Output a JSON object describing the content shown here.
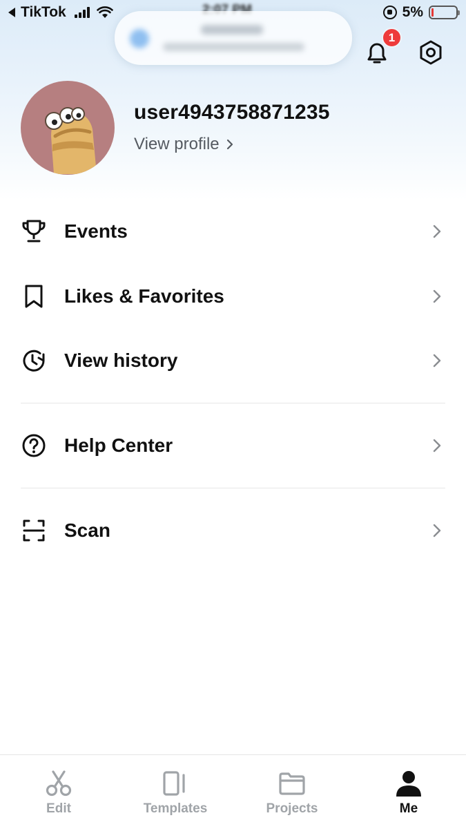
{
  "status_bar": {
    "back_app": "TikTok",
    "time": "2:07 PM",
    "battery": "5%"
  },
  "notification_pill": {
    "title": "",
    "subtitle": ""
  },
  "header": {
    "bell_icon": "bell-icon",
    "notification_count": "1",
    "settings_icon": "hexagon-settings-icon"
  },
  "profile": {
    "username": "user4943758871235",
    "view_profile": "View profile"
  },
  "menu": [
    {
      "label": "Events",
      "icon": "trophy-icon"
    },
    {
      "label": "Likes & Favorites",
      "icon": "bookmark-icon"
    },
    {
      "label": "View history",
      "icon": "history-icon"
    },
    {
      "label": "Help Center",
      "icon": "help-icon"
    },
    {
      "label": "Scan",
      "icon": "scan-icon"
    }
  ],
  "bottom_nav": [
    {
      "label": "Edit",
      "icon": "scissors-icon",
      "active": false
    },
    {
      "label": "Templates",
      "icon": "templates-icon",
      "active": false
    },
    {
      "label": "Projects",
      "icon": "folder-icon",
      "active": false
    },
    {
      "label": "Me",
      "icon": "person-icon",
      "active": true
    }
  ],
  "colors": {
    "badge": "#ee3b3b",
    "active_tab": "#111111",
    "inactive_tab": "#a0a4a8",
    "avatar_bg": "#b67f80",
    "header_gradient_top": "#dcebf8"
  }
}
